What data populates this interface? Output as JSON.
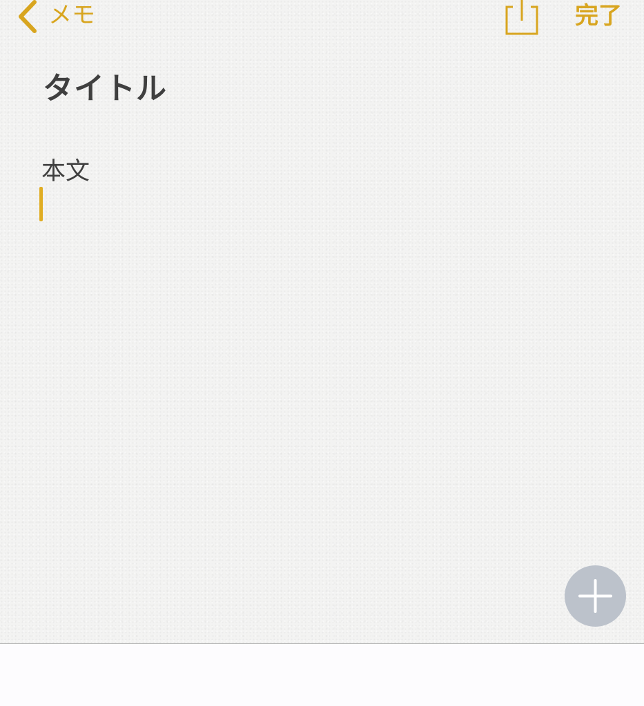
{
  "nav": {
    "back_label": "メモ",
    "done_label": "完了",
    "share_icon": "share-icon",
    "back_icon": "chevron-left-icon"
  },
  "note": {
    "title": "タイトル",
    "body": "本文"
  },
  "fab": {
    "icon": "plus-icon"
  },
  "colors": {
    "accent": "#d8a51f",
    "caret": "#e0ad23",
    "text": "#3f3f3f",
    "fab": "#bcc2cb",
    "paper": "#f3f3f2"
  }
}
